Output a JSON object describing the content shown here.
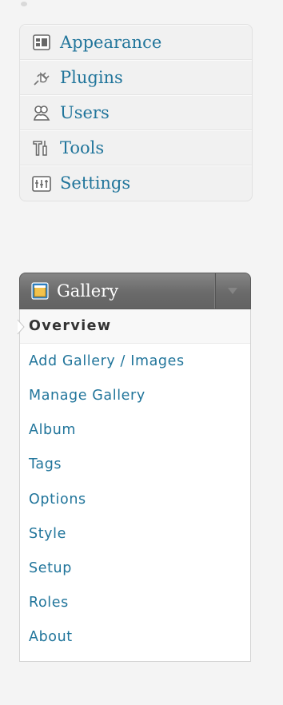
{
  "menu": {
    "items": [
      {
        "label": "Appearance",
        "icon": "appearance-icon"
      },
      {
        "label": "Plugins",
        "icon": "plugins-icon"
      },
      {
        "label": "Users",
        "icon": "users-icon"
      },
      {
        "label": "Tools",
        "icon": "tools-icon"
      },
      {
        "label": "Settings",
        "icon": "settings-icon"
      }
    ]
  },
  "gallery": {
    "title": "Gallery",
    "icon": "gallery-icon",
    "toggle_icon": "triangle-down-icon",
    "submenu": [
      {
        "label": "Overview",
        "current": true
      },
      {
        "label": "Add Gallery / Images"
      },
      {
        "label": "Manage Gallery"
      },
      {
        "label": "Album"
      },
      {
        "label": "Tags"
      },
      {
        "label": "Options"
      },
      {
        "label": "Style"
      },
      {
        "label": "Setup"
      },
      {
        "label": "Roles"
      },
      {
        "label": "About"
      }
    ]
  },
  "colors": {
    "link": "#21759b",
    "current_text": "#333333",
    "header_bg": "#6a6a6a",
    "menu_bg": "#f1f1f1"
  }
}
